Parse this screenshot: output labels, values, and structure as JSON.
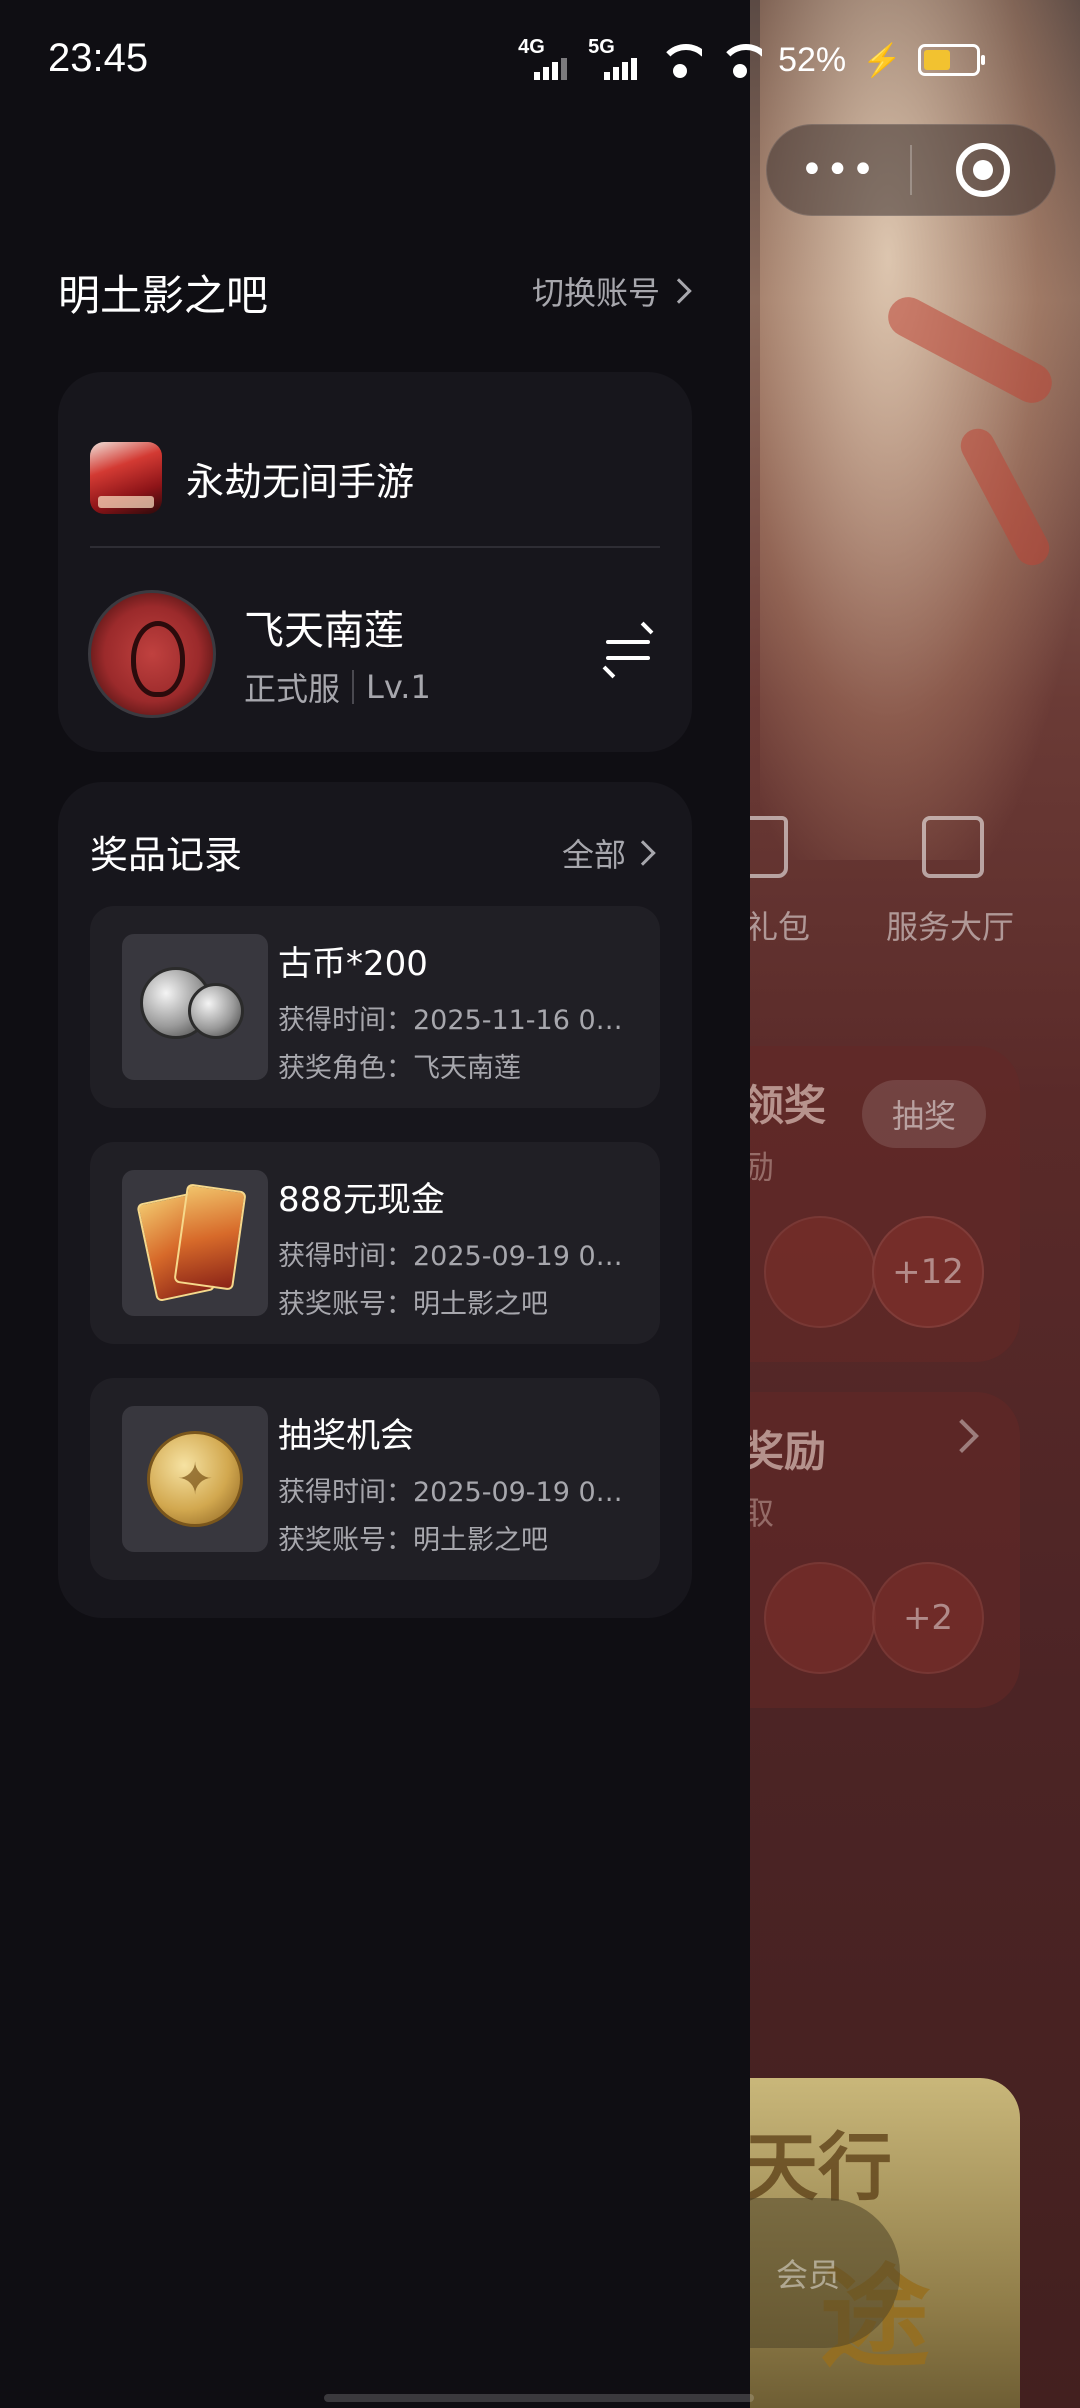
{
  "status_bar": {
    "time": "23:45",
    "network_1": "4G",
    "network_2": "5G",
    "battery_percent": "52%",
    "battery_level": 0.52,
    "battery_color": "#f2c230"
  },
  "background": {
    "menu_capsule": {
      "more_icon": "more-dots-icon",
      "close_icon": "target-circle-icon"
    },
    "shortcuts": [
      {
        "label": "礼包",
        "icon": "gift-icon"
      },
      {
        "label": "服务大厅",
        "icon": "heart-square-icon"
      }
    ],
    "panel_1": {
      "title": "领奖",
      "subtitle": "励",
      "button": "抽奖",
      "more_count": "+12"
    },
    "panel_2": {
      "title": "奖励",
      "subtitle": "取",
      "more_count": "+2"
    },
    "banner": {
      "text_1": "天行",
      "text_2": "途",
      "member_label": "会员"
    }
  },
  "drawer": {
    "account_name": "明土影之吧",
    "switch_account": "切换账号",
    "game": {
      "title": "永劫无间手游",
      "icon": "game-app-icon"
    },
    "role": {
      "name": "飞天南莲",
      "server": "正式服",
      "level": "Lv.1",
      "swap_icon": "swap-arrows-icon"
    },
    "prizes": {
      "title": "奖品记录",
      "view_all": "全部",
      "items": [
        {
          "name": "古币*200",
          "line_1": "获得时间：2025-11-16 08:…",
          "line_2": "获奖角色：飞天南莲",
          "icon": "silver-coins-icon"
        },
        {
          "name": "888元现金",
          "line_1": "获得时间：2025-09-19 07:…",
          "line_2": "获奖账号：明土影之吧",
          "icon": "cash-cards-icon"
        },
        {
          "name": "抽奖机会",
          "line_1": "获得时间：2025-09-19 07:…",
          "line_2": "获奖账号：明土影之吧",
          "icon": "gold-coin-icon"
        }
      ]
    }
  }
}
